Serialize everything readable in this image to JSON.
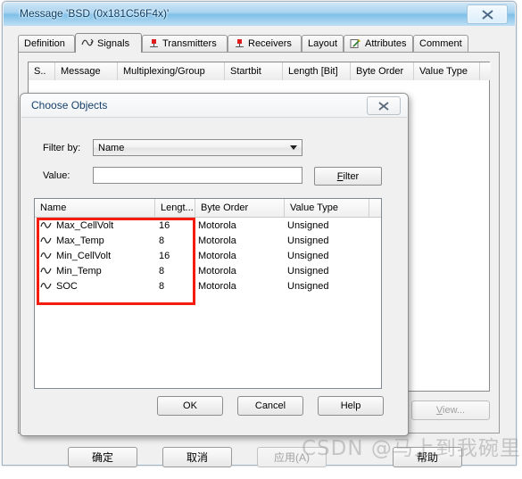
{
  "window": {
    "title": "Message 'BSD (0x181C56F4x)'",
    "close_icon": "close-icon",
    "close_glyph": "✕"
  },
  "tabs": [
    {
      "label": "Definition",
      "icon": "",
      "active": false
    },
    {
      "label": "Signals",
      "icon": "waveform-icon",
      "active": true
    },
    {
      "label": "Transmitters",
      "icon": "node-icon",
      "active": false
    },
    {
      "label": "Receivers",
      "icon": "node-icon",
      "active": false
    },
    {
      "label": "Layout",
      "icon": "",
      "active": false
    },
    {
      "label": "Attributes",
      "icon": "pencil-note-icon",
      "active": false
    },
    {
      "label": "Comment",
      "icon": "",
      "active": false
    }
  ],
  "signals_grid": {
    "columns": [
      "S..",
      "Message",
      "Multiplexing/Group",
      "Startbit",
      "Length [Bit]",
      "Byte Order",
      "Value Type"
    ],
    "rows": [],
    "view_button": {
      "label_prefix": "",
      "label": "View...",
      "accel": "V",
      "enabled": false
    }
  },
  "main_buttons": [
    {
      "label": "确定",
      "enabled": true
    },
    {
      "label": "取消",
      "enabled": true
    },
    {
      "label": "应用(A)",
      "enabled": false
    },
    {
      "label": "帮助",
      "enabled": true
    }
  ],
  "dialog": {
    "title": "Choose Objects",
    "close_glyph": "✕",
    "filter_by_label": "Filter by:",
    "filter_by_value": "Name",
    "filter_by_options": [
      "Name"
    ],
    "value_label": "Value:",
    "value_text": "",
    "value_placeholder": "",
    "filter_button": {
      "label": "Filter",
      "accel": "F"
    },
    "list": {
      "columns": [
        "Name",
        "Lengt...",
        "Byte Order",
        "Value Type",
        ""
      ],
      "rows": [
        {
          "name": "Max_CellVolt",
          "length": "16",
          "byte_order": "Motorola",
          "value_type": "Unsigned"
        },
        {
          "name": "Max_Temp",
          "length": "8",
          "byte_order": "Motorola",
          "value_type": "Unsigned"
        },
        {
          "name": "Min_CellVolt",
          "length": "16",
          "byte_order": "Motorola",
          "value_type": "Unsigned"
        },
        {
          "name": "Min_Temp",
          "length": "8",
          "byte_order": "Motorola",
          "value_type": "Unsigned"
        },
        {
          "name": "SOC",
          "length": "8",
          "byte_order": "Motorola",
          "value_type": "Unsigned"
        }
      ]
    },
    "buttons": [
      {
        "label": "OK"
      },
      {
        "label": "Cancel"
      },
      {
        "label": "Help"
      }
    ]
  },
  "annotation": {
    "type": "red-rectangle",
    "color": "#f41b0f"
  },
  "watermark": {
    "text": "CSDN @马上到我碗里来"
  }
}
